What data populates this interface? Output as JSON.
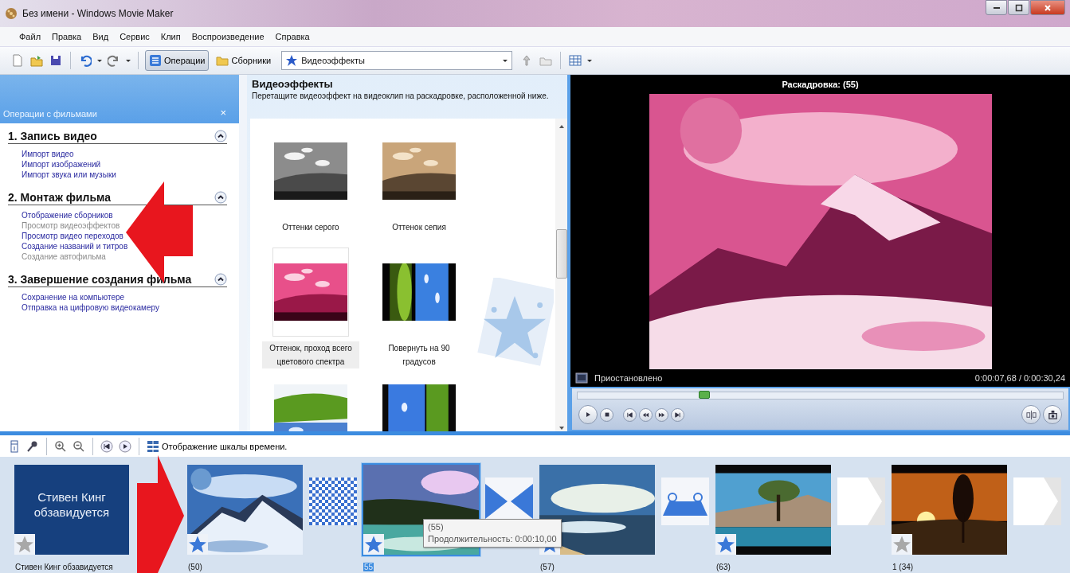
{
  "window": {
    "title": "Без имени - Windows Movie Maker"
  },
  "menu": [
    "Файл",
    "Правка",
    "Вид",
    "Сервис",
    "Клип",
    "Воспроизведение",
    "Справка"
  ],
  "toolbar": {
    "operations": {
      "label": "Операции",
      "selected": true
    },
    "collections": {
      "label": "Сборники",
      "selected": false
    },
    "combo": "Видеоэффекты"
  },
  "tasks": {
    "title": "Операции с фильмами",
    "close": "×",
    "sections": [
      {
        "title": "1. Запись видео",
        "expanded": true,
        "items": [
          {
            "label": "Импорт видео",
            "disabled": false
          },
          {
            "label": "Импорт изображений",
            "disabled": false
          },
          {
            "label": "Импорт звука или музыки",
            "disabled": false
          }
        ]
      },
      {
        "title": "2. Монтаж фильма",
        "expanded": true,
        "items": [
          {
            "label": "Отображение сборников",
            "disabled": false
          },
          {
            "label": "Просмотр видеоэффектов",
            "disabled": true
          },
          {
            "label": "Просмотр видео переходов",
            "disabled": false
          },
          {
            "label": "Создание названий и титров",
            "disabled": false
          },
          {
            "label": "Создание автофильма",
            "disabled": true
          }
        ]
      },
      {
        "title": "3. Завершение создания фильма",
        "expanded": true,
        "items": [
          {
            "label": "Сохранение на компьютере",
            "disabled": false
          },
          {
            "label": "Отправка на цифровую видеокамеру",
            "disabled": false
          }
        ]
      }
    ]
  },
  "effects": {
    "title": "Видеоэффекты",
    "hint": "Перетащите видеоэффект на видеоклип на раскадровке, расположенной ниже.",
    "items": [
      {
        "label": "Оттенки серого",
        "selected": false
      },
      {
        "label": "Оттенок сепия",
        "selected": false
      },
      {
        "label": "Оттенок, проход всего цветового спектра",
        "selected": true
      },
      {
        "label": "Повернуть на 90 градусов",
        "selected": false
      },
      {
        "selected": false
      },
      {
        "selected": false
      }
    ]
  },
  "preview": {
    "title": "Раскадровка: (55)",
    "status": "Приостановлено",
    "time": "0:00:07,68 / 0:00:30,24",
    "level": 0.26
  },
  "storyboard": {
    "view_button": "Отображение шкалы времени.",
    "items": [
      {
        "kind": "title",
        "text": "Стивен Кинг обзавидуется",
        "caption": "Стивен Кинг обзавидуется",
        "effect": false,
        "selected": false
      },
      {
        "kind": "clip",
        "caption": "(50)",
        "effect": true,
        "selected": false
      },
      {
        "kind": "transition"
      },
      {
        "kind": "clip",
        "caption": "55",
        "effect": true,
        "selected": true,
        "tooltip": {
          "title": "(55)",
          "text": "Продолжительность: 0:00:10,00"
        }
      },
      {
        "kind": "transition"
      },
      {
        "kind": "clip",
        "caption": "(57)",
        "effect": true,
        "selected": false
      },
      {
        "kind": "transition"
      },
      {
        "kind": "clip",
        "caption": "(63)",
        "effect": true,
        "selected": false
      },
      {
        "kind": "transition"
      },
      {
        "kind": "clip",
        "caption": "1 (34)",
        "effect": false,
        "selected": false
      },
      {
        "kind": "transition"
      }
    ]
  }
}
